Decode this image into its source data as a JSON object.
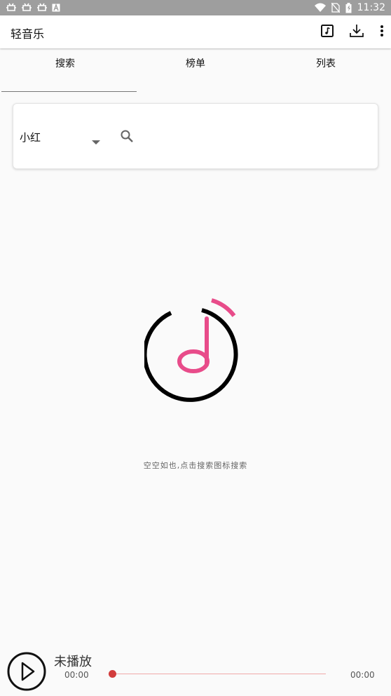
{
  "status_bar": {
    "time": "11:32",
    "notification_icons": [
      "bug-icon",
      "bug-icon",
      "bug-icon",
      "font-icon"
    ],
    "system_icons": [
      "wifi-icon",
      "no-sim-icon",
      "battery-icon"
    ]
  },
  "app_bar": {
    "title": "轻音乐",
    "actions": [
      "music-note-icon",
      "download-icon",
      "more-vert-icon"
    ]
  },
  "tabs": [
    {
      "label": "搜索",
      "selected": true
    },
    {
      "label": "榜单",
      "selected": false
    },
    {
      "label": "列表",
      "selected": false
    }
  ],
  "search": {
    "source_value": "小红",
    "icon": "search-icon"
  },
  "empty_state": {
    "message": "空空如也,点击搜索图标搜索"
  },
  "player": {
    "title": "未播放",
    "current_time": "00:00",
    "total_time": "00:00",
    "progress": 0
  },
  "colors": {
    "accent": "#e84c8a",
    "progress_thumb": "#d23c3c",
    "progress_track": "#f0a8a8",
    "status_bar": "#9e9e9e",
    "background": "#fafafa"
  }
}
